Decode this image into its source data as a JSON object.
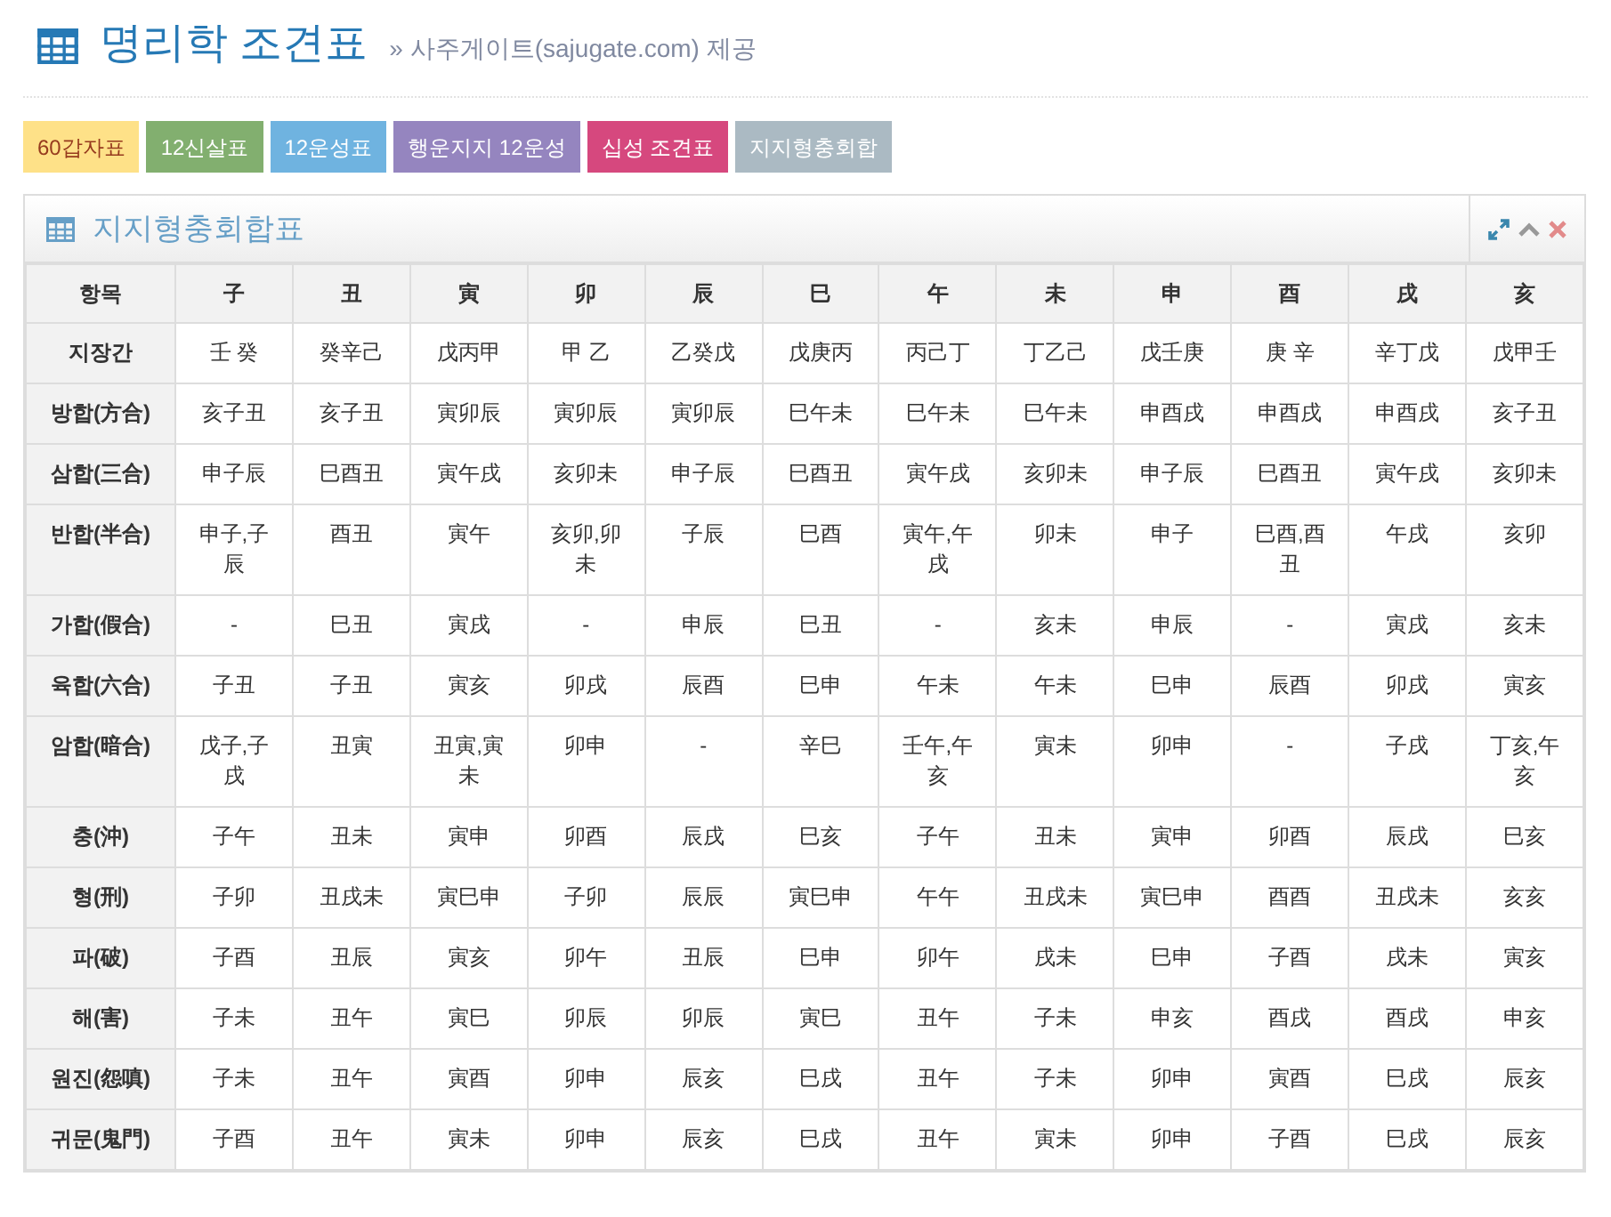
{
  "page_title": "명리학 조견표",
  "page_subtitle": "» 사주게이트(sajugate.com) 제공",
  "tabs": [
    {
      "label": "60갑자표",
      "color": "#fee188"
    },
    {
      "label": "12신살표",
      "color": "#82af6f"
    },
    {
      "label": "12운성표",
      "color": "#6fb3e0"
    },
    {
      "label": "행운지지 12운성",
      "color": "#9585bf"
    },
    {
      "label": "십성 조견표",
      "color": "#d6487e"
    },
    {
      "label": "지지형충회합",
      "color": "#abbac3"
    }
  ],
  "panel": {
    "title": "지지형충회합표",
    "table": {
      "columns": [
        "항목",
        "子",
        "丑",
        "寅",
        "卯",
        "辰",
        "巳",
        "午",
        "未",
        "申",
        "酉",
        "戌",
        "亥"
      ],
      "rows": [
        [
          "지장간",
          "壬 癸",
          "癸辛己",
          "戊丙甲",
          "甲 乙",
          "乙癸戊",
          "戊庚丙",
          "丙己丁",
          "丁乙己",
          "戊壬庚",
          "庚 辛",
          "辛丁戊",
          "戊甲壬"
        ],
        [
          "방합(方合)",
          "亥子丑",
          "亥子丑",
          "寅卯辰",
          "寅卯辰",
          "寅卯辰",
          "巳午未",
          "巳午未",
          "巳午未",
          "申酉戌",
          "申酉戌",
          "申酉戌",
          "亥子丑"
        ],
        [
          "삼합(三合)",
          "申子辰",
          "巳酉丑",
          "寅午戌",
          "亥卯未",
          "申子辰",
          "巳酉丑",
          "寅午戌",
          "亥卯未",
          "申子辰",
          "巳酉丑",
          "寅午戌",
          "亥卯未"
        ],
        [
          "반합(半合)",
          "申子,子辰",
          "酉丑",
          "寅午",
          "亥卯,卯未",
          "子辰",
          "巳酉",
          "寅午,午戌",
          "卯未",
          "申子",
          "巳酉,酉丑",
          "午戌",
          "亥卯"
        ],
        [
          "가합(假合)",
          "-",
          "巳丑",
          "寅戌",
          "-",
          "申辰",
          "巳丑",
          "-",
          "亥未",
          "申辰",
          "-",
          "寅戌",
          "亥未"
        ],
        [
          "육합(六合)",
          "子丑",
          "子丑",
          "寅亥",
          "卯戌",
          "辰酉",
          "巳申",
          "午未",
          "午未",
          "巳申",
          "辰酉",
          "卯戌",
          "寅亥"
        ],
        [
          "암합(暗合)",
          "戊子,子戌",
          "丑寅",
          "丑寅,寅未",
          "卯申",
          "-",
          "辛巳",
          "壬午,午亥",
          "寅未",
          "卯申",
          "-",
          "子戌",
          "丁亥,午亥"
        ],
        [
          "충(沖)",
          "子午",
          "丑未",
          "寅申",
          "卯酉",
          "辰戌",
          "巳亥",
          "子午",
          "丑未",
          "寅申",
          "卯酉",
          "辰戌",
          "巳亥"
        ],
        [
          "형(刑)",
          "子卯",
          "丑戌未",
          "寅巳申",
          "子卯",
          "辰辰",
          "寅巳申",
          "午午",
          "丑戌未",
          "寅巳申",
          "酉酉",
          "丑戌未",
          "亥亥"
        ],
        [
          "파(破)",
          "子酉",
          "丑辰",
          "寅亥",
          "卯午",
          "丑辰",
          "巳申",
          "卯午",
          "戌未",
          "巳申",
          "子酉",
          "戌未",
          "寅亥"
        ],
        [
          "해(害)",
          "子未",
          "丑午",
          "寅巳",
          "卯辰",
          "卯辰",
          "寅巳",
          "丑午",
          "子未",
          "申亥",
          "酉戌",
          "酉戌",
          "申亥"
        ],
        [
          "원진(怨嗔)",
          "子未",
          "丑午",
          "寅酉",
          "卯申",
          "辰亥",
          "巳戌",
          "丑午",
          "子未",
          "卯申",
          "寅酉",
          "巳戌",
          "辰亥"
        ],
        [
          "귀문(鬼門)",
          "子酉",
          "丑午",
          "寅未",
          "卯申",
          "辰亥",
          "巳戌",
          "丑午",
          "寅未",
          "卯申",
          "子酉",
          "巳戌",
          "辰亥"
        ]
      ]
    }
  }
}
